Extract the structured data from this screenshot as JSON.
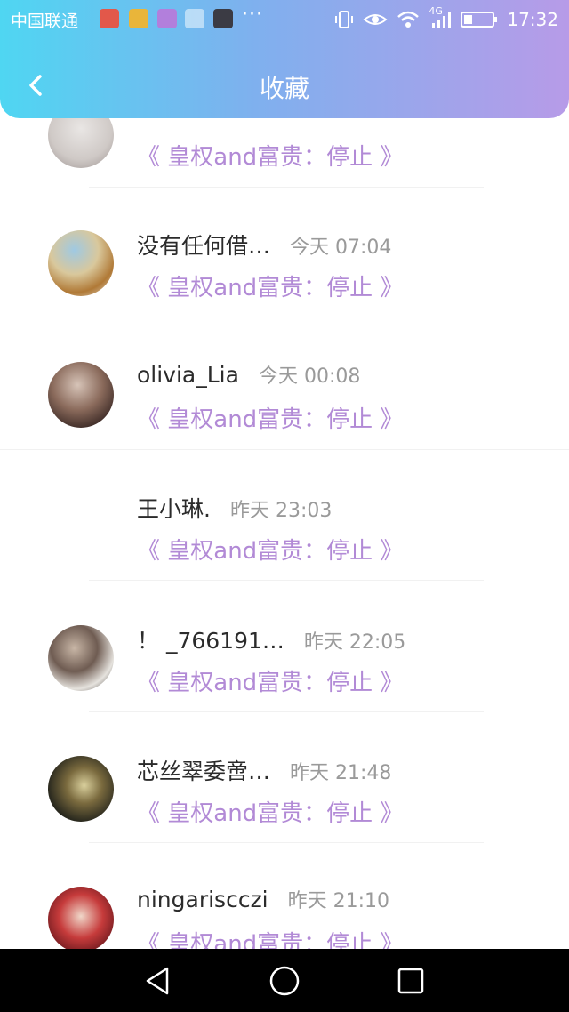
{
  "status_bar": {
    "carrier": "中国联通",
    "dots": "···",
    "network": "4G",
    "time": "17:32"
  },
  "header": {
    "title": "收藏"
  },
  "favorites": [
    {
      "name": "",
      "time": "",
      "ref": "《 皇权and富贵：停止 》",
      "avatar": "avatar-partial"
    },
    {
      "name": "没有任何借…",
      "time": "今天 07:04",
      "ref": "《 皇权and富贵：停止 》",
      "avatar": "avatar-cat-towel"
    },
    {
      "name": "olivia_Lia",
      "time": "今天 00:08",
      "ref": "《 皇权and富贵：停止 》",
      "avatar": "avatar-woman-dark"
    },
    {
      "name": "王小琳.",
      "time": "昨天 23:03",
      "ref": "《 皇权and富贵：停止 》",
      "avatar": "avatar-none"
    },
    {
      "name": "！ _766191…",
      "time": "昨天 22:05",
      "ref": "《 皇权and富贵：停止 》",
      "avatar": "avatar-boy-sign"
    },
    {
      "name": "芯丝翠委啻…",
      "time": "昨天 21:48",
      "ref": "《 皇权and富贵：停止 》",
      "avatar": "avatar-dark-scene"
    },
    {
      "name": "ningariscczi",
      "time": "昨天 21:10",
      "ref": "《 皇权and富贵：停止 》",
      "avatar": "avatar-red-woman"
    }
  ],
  "colors": {
    "header_gradient_start": "#4fd6f2",
    "header_gradient_end": "#b79be8",
    "reference_text": "#b28ad6"
  }
}
